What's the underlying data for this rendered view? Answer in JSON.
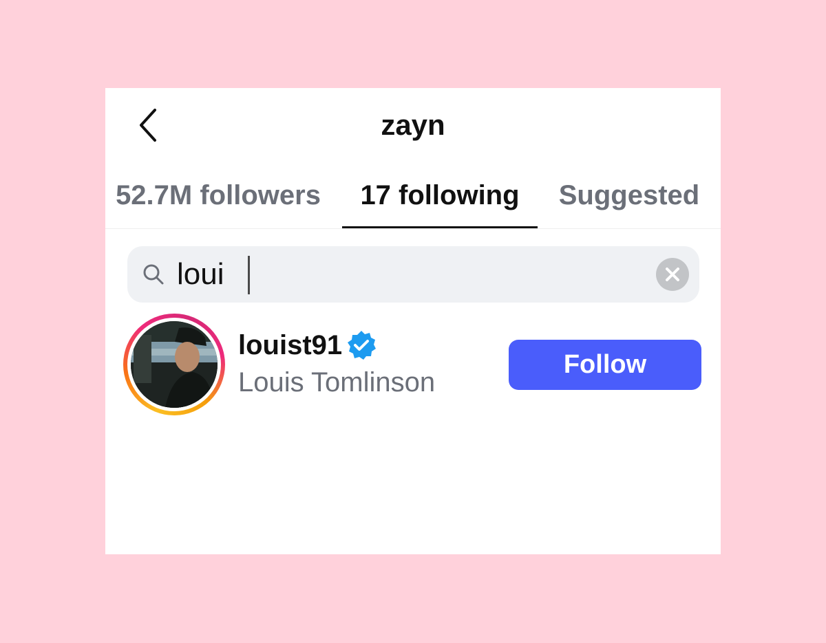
{
  "header": {
    "title": "zayn",
    "back_icon": "chevron-left-icon"
  },
  "tabs": [
    {
      "label": "52.7M followers",
      "active": false
    },
    {
      "label": "17 following",
      "active": true
    },
    {
      "label": "Suggested",
      "active": false
    }
  ],
  "search": {
    "value": "loui",
    "icon": "search-icon",
    "clear_icon": "clear-icon"
  },
  "results": [
    {
      "username": "louist91",
      "full_name": "Louis Tomlinson",
      "verified": true,
      "follow_label": "Follow"
    }
  ],
  "colors": {
    "background": "#ffd1db",
    "accent": "#4a5dfb",
    "verified": "#1d9bf0"
  }
}
